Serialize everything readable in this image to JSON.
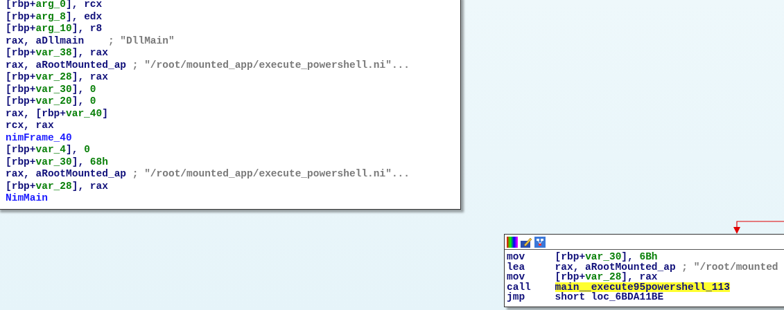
{
  "graph": {
    "nodes": [
      {
        "lines": [
          {
            "tokens": [
              {
                "text": "[rbp+",
                "kind": "plain"
              },
              {
                "text": "arg_0",
                "kind": "var"
              },
              {
                "text": "], rcx",
                "kind": "plain"
              }
            ]
          },
          {
            "tokens": [
              {
                "text": "[rbp+",
                "kind": "plain"
              },
              {
                "text": "arg_8",
                "kind": "var"
              },
              {
                "text": "], edx",
                "kind": "plain"
              }
            ]
          },
          {
            "tokens": [
              {
                "text": "[rbp+",
                "kind": "plain"
              },
              {
                "text": "arg_10",
                "kind": "var"
              },
              {
                "text": "], r8",
                "kind": "plain"
              }
            ]
          },
          {
            "tokens": [
              {
                "text": "rax, aDllmain    ",
                "kind": "plain"
              },
              {
                "text": "; \"DllMain\"",
                "kind": "comment"
              }
            ]
          },
          {
            "tokens": [
              {
                "text": "[rbp+",
                "kind": "plain"
              },
              {
                "text": "var_38",
                "kind": "var"
              },
              {
                "text": "], rax",
                "kind": "plain"
              }
            ]
          },
          {
            "tokens": [
              {
                "text": "rax, aRootMounted_ap ",
                "kind": "plain"
              },
              {
                "text": "; \"/root/mounted_app/execute_powershell.ni\"...",
                "kind": "comment"
              }
            ]
          },
          {
            "tokens": [
              {
                "text": "[rbp+",
                "kind": "plain"
              },
              {
                "text": "var_28",
                "kind": "var"
              },
              {
                "text": "], rax",
                "kind": "plain"
              }
            ]
          },
          {
            "tokens": [
              {
                "text": "[rbp+",
                "kind": "plain"
              },
              {
                "text": "var_30",
                "kind": "var"
              },
              {
                "text": "], ",
                "kind": "plain"
              },
              {
                "text": "0",
                "kind": "num"
              }
            ]
          },
          {
            "tokens": [
              {
                "text": "[rbp+",
                "kind": "plain"
              },
              {
                "text": "var_20",
                "kind": "var"
              },
              {
                "text": "], ",
                "kind": "plain"
              },
              {
                "text": "0",
                "kind": "num"
              }
            ]
          },
          {
            "tokens": [
              {
                "text": "rax, [rbp+",
                "kind": "plain"
              },
              {
                "text": "var_40",
                "kind": "var"
              },
              {
                "text": "]",
                "kind": "plain"
              }
            ]
          },
          {
            "tokens": [
              {
                "text": "rcx, rax",
                "kind": "plain"
              }
            ]
          },
          {
            "tokens": [
              {
                "text": "nimFrame_40",
                "kind": "name"
              }
            ]
          },
          {
            "tokens": [
              {
                "text": "[rbp+",
                "kind": "plain"
              },
              {
                "text": "var_4",
                "kind": "var"
              },
              {
                "text": "], ",
                "kind": "plain"
              },
              {
                "text": "0",
                "kind": "num"
              }
            ]
          },
          {
            "tokens": [
              {
                "text": "[rbp+",
                "kind": "plain"
              },
              {
                "text": "var_30",
                "kind": "var"
              },
              {
                "text": "], ",
                "kind": "plain"
              },
              {
                "text": "68h",
                "kind": "num"
              }
            ]
          },
          {
            "tokens": [
              {
                "text": "rax, aRootMounted_ap ",
                "kind": "plain"
              },
              {
                "text": "; \"/root/mounted_app/execute_powershell.ni\"...",
                "kind": "comment"
              }
            ]
          },
          {
            "tokens": [
              {
                "text": "[rbp+",
                "kind": "plain"
              },
              {
                "text": "var_28",
                "kind": "var"
              },
              {
                "text": "], rax",
                "kind": "plain"
              }
            ]
          },
          {
            "tokens": [
              {
                "text": "NimMain",
                "kind": "name"
              }
            ]
          }
        ]
      },
      {
        "lines": [
          {
            "mnemonic": "mov",
            "highlighted": false,
            "tokens": [
              {
                "text": "[rbp+",
                "kind": "plain"
              },
              {
                "text": "var_30",
                "kind": "var"
              },
              {
                "text": "], ",
                "kind": "plain"
              },
              {
                "text": "6Bh",
                "kind": "num"
              }
            ]
          },
          {
            "mnemonic": "lea",
            "highlighted": false,
            "tokens": [
              {
                "text": "rax, aRootMounted_ap ",
                "kind": "plain"
              },
              {
                "text": "; \"/root/mounted",
                "kind": "comment"
              }
            ]
          },
          {
            "mnemonic": "mov",
            "highlighted": false,
            "tokens": [
              {
                "text": "[rbp+",
                "kind": "plain"
              },
              {
                "text": "var_28",
                "kind": "var"
              },
              {
                "text": "], rax",
                "kind": "plain"
              }
            ]
          },
          {
            "mnemonic": "call",
            "highlighted": true,
            "tokens": [
              {
                "text": "main__execute95powershell_113",
                "kind": "plain"
              }
            ]
          },
          {
            "mnemonic": "jmp",
            "highlighted": false,
            "tokens": [
              {
                "text": "short loc_6BDA11BE",
                "kind": "plain"
              }
            ]
          }
        ]
      }
    ]
  }
}
